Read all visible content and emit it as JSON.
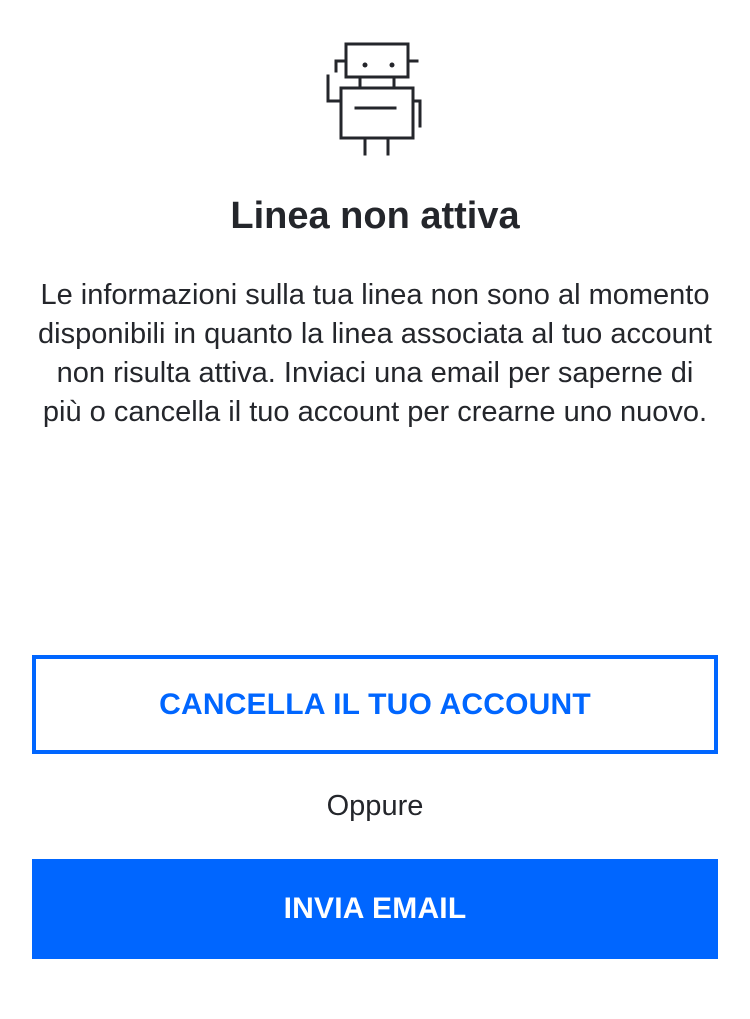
{
  "illustration": {
    "icon": "robot-icon"
  },
  "title": "Linea non attiva",
  "description": "Le informazioni sulla tua linea non sono al momento disponibili in quanto la linea associata al tuo account non risulta attiva. Inviaci una email per saperne di più o cancella il tuo account per crearne uno nuovo.",
  "actions": {
    "delete_account_label": "CANCELLA IL TUO ACCOUNT",
    "separator_text": "Oppure",
    "send_email_label": "INVIA EMAIL"
  },
  "colors": {
    "accent": "#0066ff",
    "text": "#24262b",
    "background": "#ffffff"
  }
}
